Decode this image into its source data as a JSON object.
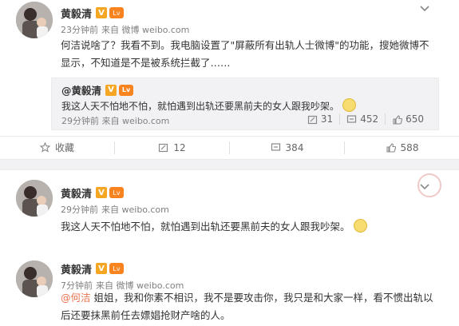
{
  "posts": [
    {
      "username": "黄毅清",
      "v_badge": "V",
      "level_badge": "Lv",
      "time": "23分钟前",
      "source": "来自 微博 weibo.com",
      "text": "何洁说啥了？我看不到。我电脑设置了\"屏蔽所有出轨人士微博\"的功能，搜她微博不显示，不知道是不是被系统拦截了……",
      "repost": {
        "username": "@黄毅清",
        "text": "我这人天不怕地不怕，就怕遇到出轨还要黑前夫的女人跟我吵架。",
        "time": "29分钟前",
        "source": "来自 weibo.com",
        "repost_count": "31",
        "comment_count": "452",
        "like_count": "650"
      },
      "actions": {
        "favorite_label": "收藏",
        "repost_count": "12",
        "comment_count": "384",
        "like_count": "588"
      }
    },
    {
      "username": "黄毅清",
      "v_badge": "V",
      "level_badge": "Lv",
      "time": "29分钟前",
      "source": "来自 weibo.com",
      "text": "我这人天不怕地不怕，就怕遇到出轨还要黑前夫的女人跟我吵架。"
    },
    {
      "username": "黄毅清",
      "v_badge": "V",
      "level_badge": "Lv",
      "time": "7分钟前",
      "source": "来自 微博 weibo.com",
      "mention": "@何洁",
      "text": " 姐姐，我和你素不相识，我不是要攻击你，我只是和大家一样，看不惯出轨以后还要抹黑前任去嫖娼抢财产啥的人。"
    }
  ],
  "icons": {
    "avatar": "avatar-photo",
    "chevron": "chevron-down-icon",
    "favorite": "star-icon",
    "repost": "repost-icon",
    "comment": "comment-icon",
    "like": "thumbs-up-icon",
    "emoji": "smiley-emoji-icon"
  },
  "colors": {
    "mention": "#eb7350",
    "meta": "#808080",
    "badge_v": "#f5a623",
    "badge_level": "#f8831f",
    "quote_bg": "#f2f2f5"
  }
}
